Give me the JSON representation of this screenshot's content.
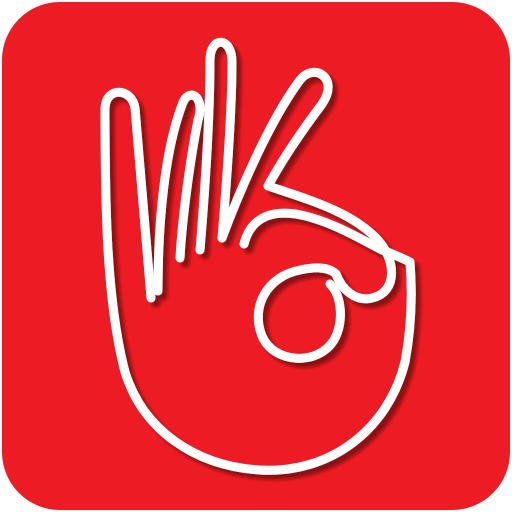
{
  "icon": {
    "name": "ok-hand-gesture-icon",
    "background_color": "#ED1C24",
    "outline_color": "#FFFFFF",
    "shadow_color": "#7A0A10"
  }
}
